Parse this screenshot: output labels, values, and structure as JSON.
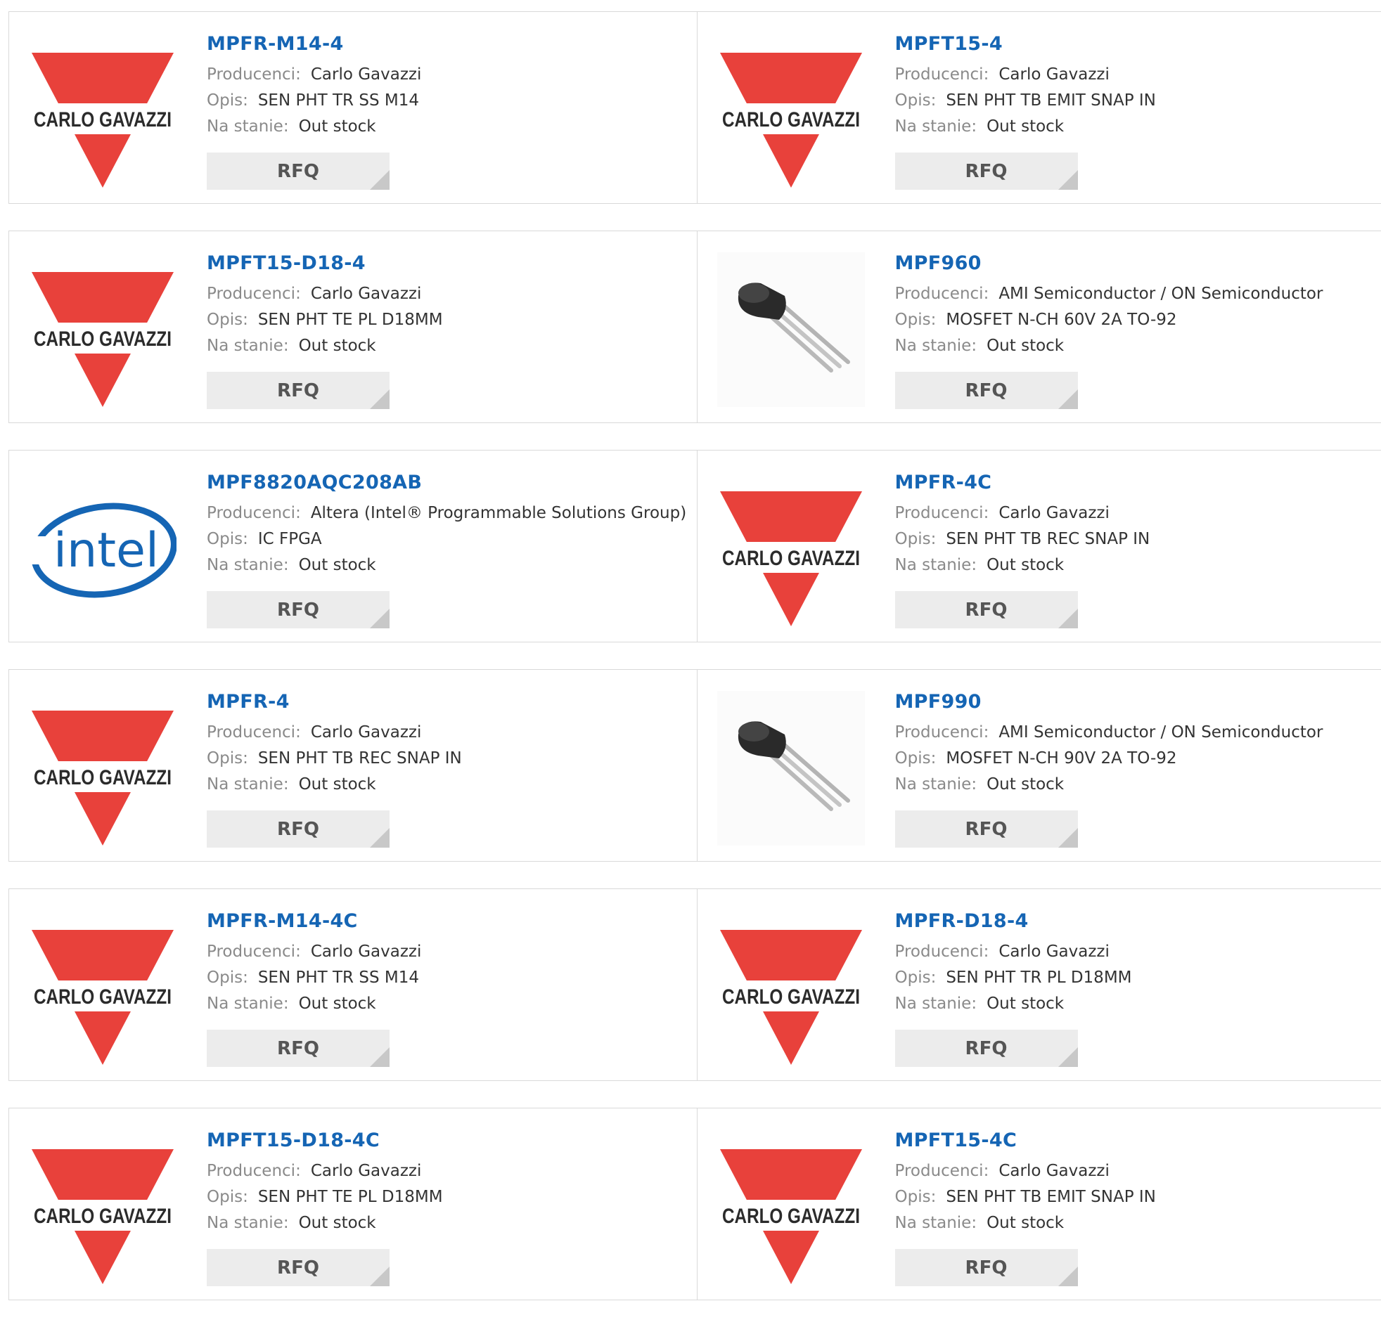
{
  "labels": {
    "manufacturer": "Producenci:",
    "description": "Opis:",
    "stock": "Na stanie:",
    "rfq_button": "RFQ"
  },
  "brands": {
    "carlo_gavazzi": {
      "text": "CARLO GAVAZZI",
      "color": "#e8413b"
    },
    "intel": {
      "text": "intel",
      "color": "#1565b4"
    }
  },
  "products": [
    {
      "part": "MPFR-M14-4",
      "manufacturer": "Carlo Gavazzi",
      "description": "SEN PHT TR SS M14",
      "stock": "Out stock",
      "logo": "carlo-gavazzi"
    },
    {
      "part": "MPFT15-4",
      "manufacturer": "Carlo Gavazzi",
      "description": "SEN PHT TB EMIT SNAP IN",
      "stock": "Out stock",
      "logo": "carlo-gavazzi"
    },
    {
      "part": "MPFT15-D18-4",
      "manufacturer": "Carlo Gavazzi",
      "description": "SEN PHT TE PL D18MM",
      "stock": "Out stock",
      "logo": "carlo-gavazzi"
    },
    {
      "part": "MPF960",
      "manufacturer": "AMI Semiconductor / ON Semiconductor",
      "description": "MOSFET N-CH 60V 2A TO-92",
      "stock": "Out stock",
      "logo": "to92-transistor"
    },
    {
      "part": "MPF8820AQC208AB",
      "manufacturer": "Altera (Intel® Programmable Solutions Group)",
      "description": "IC FPGA",
      "stock": "Out stock",
      "logo": "intel"
    },
    {
      "part": "MPFR-4C",
      "manufacturer": "Carlo Gavazzi",
      "description": "SEN PHT TB REC SNAP IN",
      "stock": "Out stock",
      "logo": "carlo-gavazzi"
    },
    {
      "part": "MPFR-4",
      "manufacturer": "Carlo Gavazzi",
      "description": "SEN PHT TB REC SNAP IN",
      "stock": "Out stock",
      "logo": "carlo-gavazzi"
    },
    {
      "part": "MPF990",
      "manufacturer": "AMI Semiconductor / ON Semiconductor",
      "description": "MOSFET N-CH 90V 2A TO-92",
      "stock": "Out stock",
      "logo": "to92-transistor"
    },
    {
      "part": "MPFR-M14-4C",
      "manufacturer": "Carlo Gavazzi",
      "description": "SEN PHT TR SS M14",
      "stock": "Out stock",
      "logo": "carlo-gavazzi"
    },
    {
      "part": "MPFR-D18-4",
      "manufacturer": "Carlo Gavazzi",
      "description": "SEN PHT TR PL D18MM",
      "stock": "Out stock",
      "logo": "carlo-gavazzi"
    },
    {
      "part": "MPFT15-D18-4C",
      "manufacturer": "Carlo Gavazzi",
      "description": "SEN PHT TE PL D18MM",
      "stock": "Out stock",
      "logo": "carlo-gavazzi"
    },
    {
      "part": "MPFT15-4C",
      "manufacturer": "Carlo Gavazzi",
      "description": "SEN PHT TB EMIT SNAP IN",
      "stock": "Out stock",
      "logo": "carlo-gavazzi"
    }
  ]
}
